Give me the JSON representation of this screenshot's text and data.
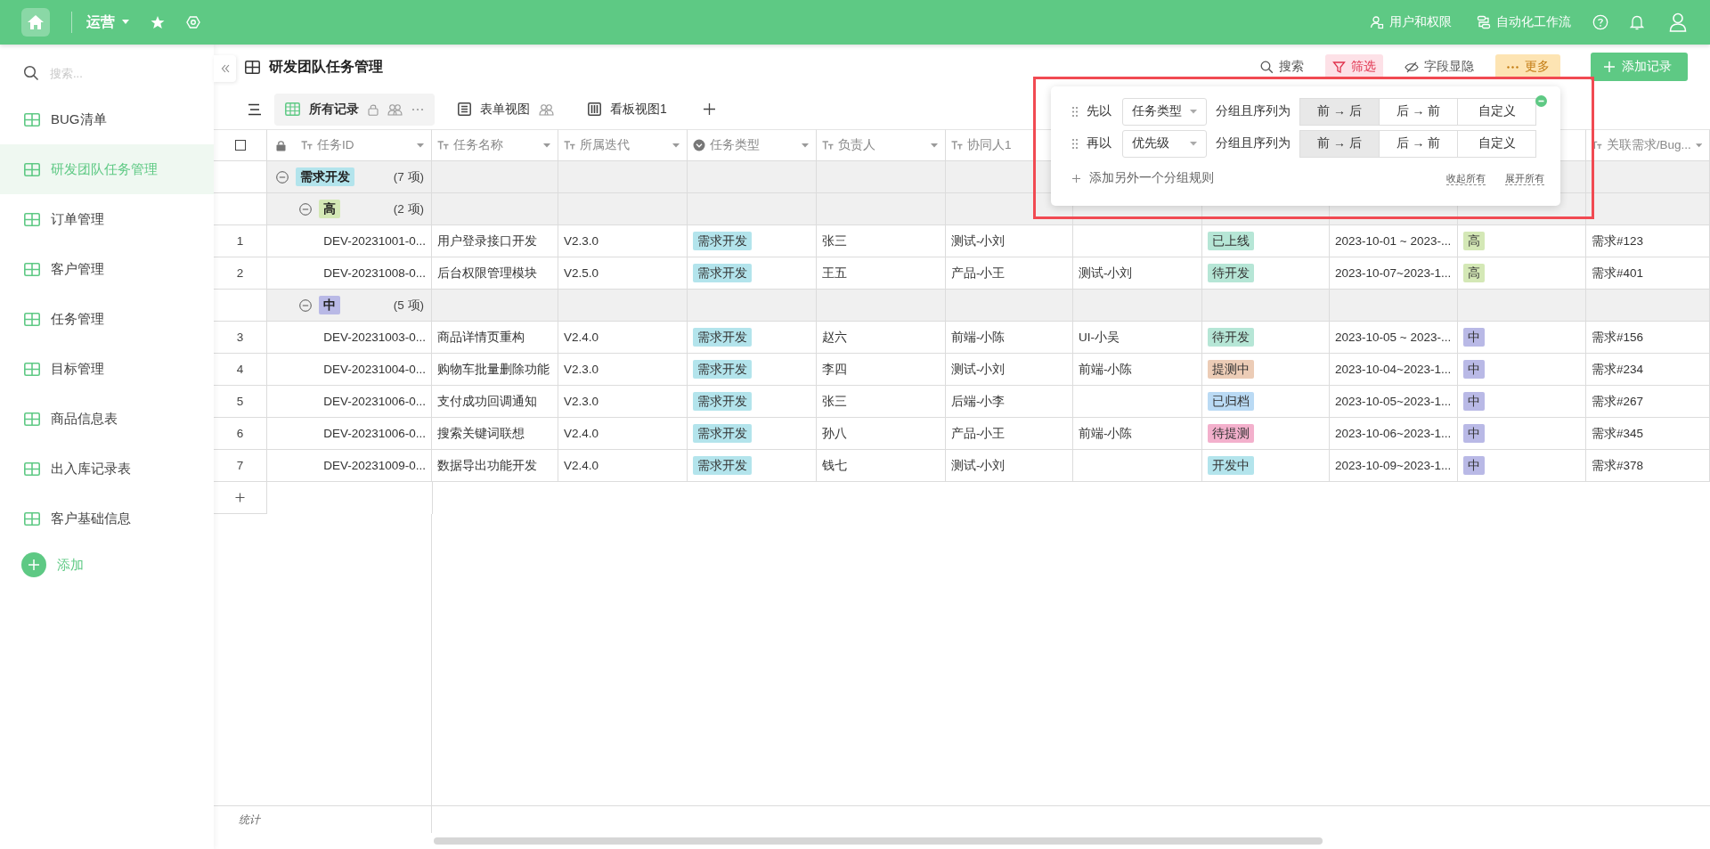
{
  "topbar": {
    "workspace": "运营",
    "links": [
      {
        "kind": "permissions",
        "label": "用户和权限"
      },
      {
        "kind": "workflow",
        "label": "自动化工作流"
      }
    ]
  },
  "sidebar": {
    "search_placeholder": "搜索...",
    "items": [
      {
        "label": "BUG清单",
        "selected": false
      },
      {
        "label": "研发团队任务管理",
        "selected": true
      },
      {
        "label": "订单管理",
        "selected": false
      },
      {
        "label": "客户管理",
        "selected": false
      },
      {
        "label": "任务管理",
        "selected": false
      },
      {
        "label": "目标管理",
        "selected": false
      },
      {
        "label": "商品信息表",
        "selected": false
      },
      {
        "label": "出入库记录表",
        "selected": false
      },
      {
        "label": "客户基础信息",
        "selected": false
      }
    ],
    "add_label": "添加"
  },
  "page": {
    "title": "研发团队任务管理"
  },
  "toolbar": [
    {
      "kind": "search",
      "label": "搜索"
    },
    {
      "kind": "filter",
      "label": "筛选",
      "color": "#fde1e7"
    },
    {
      "kind": "fields",
      "label": "字段显隐"
    },
    {
      "kind": "more",
      "label": "更多",
      "color": "#fde4b3"
    }
  ],
  "add_record": "添加记录",
  "views": [
    {
      "kind": "grid",
      "label": "所有记录",
      "selected": true,
      "locked": true,
      "shared": true,
      "menu": true
    },
    {
      "kind": "form",
      "label": "表单视图",
      "selected": false,
      "locked": false,
      "shared": true,
      "menu": false
    },
    {
      "kind": "kanban",
      "label": "看板视图1",
      "selected": false,
      "locked": false,
      "shared": false,
      "menu": false
    }
  ],
  "table": {
    "select_all": {
      "checked": false
    },
    "columns": [
      {
        "kind": "text",
        "label": "任务ID",
        "locked": true
      },
      {
        "kind": "text",
        "label": "任务名称",
        "locked": false
      },
      {
        "kind": "text",
        "label": "所属迭代",
        "locked": false
      },
      {
        "kind": "select",
        "label": "任务类型",
        "locked": false
      },
      {
        "kind": "text",
        "label": "负责人",
        "locked": false
      },
      {
        "kind": "text",
        "label": "协同人1",
        "locked": false
      }
    ],
    "last_column": {
      "kind": "text",
      "label": "关联需求/Bug..."
    },
    "groups": [
      {
        "label": "需求开发",
        "color": "#b3e4ec",
        "count": "(7 项)",
        "expanded": true,
        "children": [
          {
            "label": "高",
            "color": "#d4e8b6",
            "count": "(2 项)",
            "expanded": true,
            "rows": [
              {
                "number": "1",
                "id": "DEV-20231001-0...",
                "name": "用户登录接口开发",
                "iteration": "V2.3.0",
                "type": {
                  "label": "需求开发",
                  "color": "#b3e4ec"
                },
                "owner": "张三",
                "collaborator_1": "测试-小刘",
                "status": {
                  "label": "已上线",
                  "color": "#b6e6d6"
                },
                "dates": "2023-10-01 ~ 2023-...",
                "priority": {
                  "label": "高",
                  "color": "#d4e8b6"
                },
                "related": "需求#123"
              },
              {
                "number": "2",
                "id": "DEV-20231008-0...",
                "name": "后台权限管理模块",
                "iteration": "V2.5.0",
                "type": {
                  "label": "需求开发",
                  "color": "#b3e4ec"
                },
                "owner": "王五",
                "collaborator_1": "产品-小王",
                "column_8": "测试-小刘",
                "status": {
                  "label": "待开发",
                  "color": "#b6e6d6"
                },
                "dates": "2023-10-07~2023-1...",
                "priority": {
                  "label": "高",
                  "color": "#d4e8b6"
                },
                "related": "需求#401"
              }
            ]
          },
          {
            "label": "中",
            "color": "#b9b9e6",
            "count": "(5 项)",
            "expanded": true,
            "rows": [
              {
                "number": "3",
                "id": "DEV-20231003-0...",
                "name": "商品详情页重构",
                "iteration": "V2.4.0",
                "type": {
                  "label": "需求开发",
                  "color": "#b3e4ec"
                },
                "owner": "赵六",
                "collaborator_1": "前端-小陈",
                "column_8": "UI-小吴",
                "status": {
                  "label": "待开发",
                  "color": "#b6e6d6"
                },
                "dates": "2023-10-05 ~ 2023-...",
                "priority": {
                  "label": "中",
                  "color": "#b9b9e6"
                },
                "related": "需求#156"
              },
              {
                "number": "4",
                "id": "DEV-20231004-0...",
                "name": "购物车批量删除功能",
                "iteration": "V2.3.0",
                "type": {
                  "label": "需求开发",
                  "color": "#b3e4ec"
                },
                "owner": "李四",
                "collaborator_1": "测试-小刘",
                "column_8": "前端-小陈",
                "status": {
                  "label": "提测中",
                  "color": "#ecccb6"
                },
                "dates": "2023-10-04~2023-1...",
                "priority": {
                  "label": "中",
                  "color": "#b9b9e6"
                },
                "related": "需求#234"
              },
              {
                "number": "5",
                "id": "DEV-20231006-0...",
                "name": "支付成功回调通知",
                "iteration": "V2.3.0",
                "type": {
                  "label": "需求开发",
                  "color": "#b3e4ec"
                },
                "owner": "张三",
                "collaborator_1": "后端-小李",
                "status": {
                  "label": "已归档",
                  "color": "#badaf4"
                },
                "dates": "2023-10-05~2023-1...",
                "priority": {
                  "label": "中",
                  "color": "#b9b9e6"
                },
                "related": "需求#267"
              },
              {
                "number": "6",
                "id": "DEV-20231006-0...",
                "name": "搜索关键词联想",
                "iteration": "V2.4.0",
                "type": {
                  "label": "需求开发",
                  "color": "#b3e4ec"
                },
                "owner": "孙八",
                "collaborator_1": "产品-小王",
                "column_8": "前端-小陈",
                "status": {
                  "label": "待提测",
                  "color": "#f3b0cc"
                },
                "dates": "2023-10-06~2023-1...",
                "priority": {
                  "label": "中",
                  "color": "#b9b9e6"
                },
                "related": "需求#345"
              },
              {
                "number": "7",
                "id": "DEV-20231009-0...",
                "name": "数据导出功能开发",
                "iteration": "V2.4.0",
                "type": {
                  "label": "需求开发",
                  "color": "#b3e4ec"
                },
                "owner": "钱七",
                "collaborator_1": "测试-小刘",
                "status": {
                  "label": "开发中",
                  "color": "#b3e4ec"
                },
                "dates": "2023-10-09~2023-1...",
                "priority": {
                  "label": "中",
                  "color": "#b9b9e6"
                },
                "related": "需求#378"
              }
            ]
          }
        ]
      }
    ],
    "footer": "统计"
  },
  "group_popup": {
    "rules": [
      {
        "prefix": "先以",
        "field": "任务类型",
        "middle": "分组且序列为",
        "orders": [
          {
            "label": "前 → 后",
            "selected": true
          },
          {
            "label": "后 → 前",
            "selected": false
          },
          {
            "label": "自定义",
            "selected": false
          }
        ]
      },
      {
        "prefix": "再以",
        "field": "优先级",
        "middle": "分组且序列为",
        "orders": [
          {
            "label": "前 → 后",
            "selected": true
          },
          {
            "label": "后 → 前",
            "selected": false
          },
          {
            "label": "自定义",
            "selected": false
          }
        ]
      }
    ],
    "add_rule": "添加另外一个分组规则",
    "collapse_all": "收起所有",
    "expand_all": "展开所有"
  }
}
